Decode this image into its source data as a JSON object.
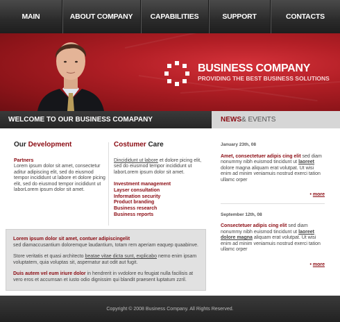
{
  "nav": {
    "items": [
      "MAIN",
      "ABOUT COMPANY",
      "CAPABILITIES",
      "SUPPORT",
      "CONTACTS"
    ]
  },
  "hero": {
    "title": "BUSINESS COMPANY",
    "subtitle": "PROVIDING THE BEST BUSINESS SOLUTIONS"
  },
  "welcome_bar": "WELCOME TO OUR BUSINESS COMAPANY",
  "news_bar": {
    "red": "NEWS",
    "rest": " & EVENTS"
  },
  "development": {
    "heading_a": "Our ",
    "heading_b": "Development",
    "subhead": "Partners",
    "text": "Lorem ipsum dolor sit amet, consectetur aditur adipiscing elit, sed do eiusmod tempor incididunt ut labore et dolore picing elit, sed do eiusmod tempor incididunt ut laborLorem ipsum dolor sit amet."
  },
  "care": {
    "heading_a": "Costumer ",
    "heading_b": "Care",
    "text_u": "Dincididunt ut labore",
    "text_rest": " et dolore picing elit, sed do eiusmod tempor incididunt ut laborLorem ipsum dolor sit amet.",
    "services": [
      "Investment management",
      "Layser consultation",
      "Information security",
      "Product branding",
      "Business research",
      "Business reports"
    ]
  },
  "graybox": {
    "heading": "Lorem ipsum dolor sit amet, contuer adipiscingelit",
    "line1": "sed diamaccusantium doloremque laudantium, totam rem aperiam eaquep quaabinve.",
    "p2_a": "Store veritatis et quasi architecto ",
    "p2_u": "beatae vitae dicta sunt, explicabo",
    "p2_b": " nemo enim ipsam voluptatem, quia voluptas sit, aspernatur aut odit aut fugit.",
    "p3_red": "Duis autem vel eum iriure dolor",
    "p3_rest": " in hendrerit in vvdolore eu feugiat nulla facilisis at vero eros et accumsan et iusto odio dignissim qui blandit praesent luptatum zzril."
  },
  "news": [
    {
      "date": "January 23th, 08",
      "head": "Amet, consectetuer adipis cing elit",
      "t1": " sed diam nonummy nibh euismod tincidunt ut ",
      "u": "laoreet",
      "t2": " dolore magna aliquam erat volutpat. Ut wisi enim ad minim veniamuis nostrud exerci tation ullamc orper",
      "more": "more"
    },
    {
      "date": "September 12th, 08",
      "head": "Consectetuer adipis cing elit",
      "t1": " sed diam nonummy nibh euismod tincidunt ut ",
      "u": "laoreet dolore magna",
      "t2": " aliquam erat volutpat. Ut wisi enim ad minim veniamuis nostrud exerci tation ullamc orper",
      "more": "more"
    }
  ],
  "footer": "Copyright © 2008 Business Company. All Rights Reserved."
}
